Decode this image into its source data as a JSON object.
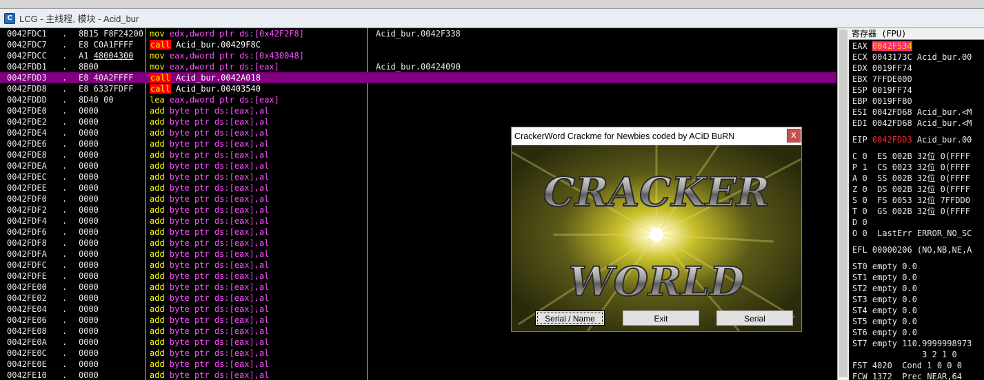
{
  "window": {
    "title": "LCG - 主线程, 模块 - Acid_bur"
  },
  "disasm": [
    {
      "addr": "0042FDC1",
      "dot": ".",
      "hex": "8B15 F8F24200",
      "ins": [
        {
          "t": "mov ",
          "c": "kw-mov"
        },
        {
          "t": "edx",
          "c": "reg"
        },
        {
          "t": ",dword ptr ds:[0x42F2F8]",
          "c": "op"
        }
      ],
      "comment": "Acid_bur.0042F338"
    },
    {
      "addr": "0042FDC7",
      "dot": ".",
      "hex": "E8 C0A1FFFF",
      "ins": [
        {
          "t": "call",
          "c": "call"
        },
        {
          "t": " Acid_bur.00429F8C",
          "c": "cname"
        }
      ],
      "comment": ""
    },
    {
      "addr": "0042FDCC",
      "dot": ".",
      "hex": "A1 48004300",
      "hexu": true,
      "ins": [
        {
          "t": "mov ",
          "c": "kw-mov"
        },
        {
          "t": "eax",
          "c": "reg"
        },
        {
          "t": ",dword ptr ds:[0x430048]",
          "c": "op"
        }
      ],
      "comment": ""
    },
    {
      "addr": "0042FDD1",
      "dot": ".",
      "hex": "8B00",
      "ins": [
        {
          "t": "mov ",
          "c": "kw-mov"
        },
        {
          "t": "eax",
          "c": "reg"
        },
        {
          "t": ",dword ptr ds:[eax]",
          "c": "op"
        }
      ],
      "comment": "Acid_bur.00424090"
    },
    {
      "addr": "0042FDD3",
      "dot": ".",
      "hex": "E8 40A2FFFF",
      "sel": true,
      "ins": [
        {
          "t": "call",
          "c": "call"
        },
        {
          "t": " Acid_bur.0042A018",
          "c": "cname"
        }
      ],
      "comment": ""
    },
    {
      "addr": "0042FDD8",
      "dot": ".",
      "hex": "E8 6337FDFF",
      "ins": [
        {
          "t": "call",
          "c": "call"
        },
        {
          "t": " Acid_bur.00403540",
          "c": "cname"
        }
      ],
      "comment": ""
    },
    {
      "addr": "0042FDDD",
      "dot": ".",
      "hex": "8D40 00",
      "ins": [
        {
          "t": "lea ",
          "c": "kw-lea"
        },
        {
          "t": "eax",
          "c": "reg"
        },
        {
          "t": ",dword ptr ds:[eax]",
          "c": "op"
        }
      ],
      "comment": ""
    },
    {
      "addr": "0042FDE0",
      "dot": ".",
      "hex": "0000",
      "add": true
    },
    {
      "addr": "0042FDE2",
      "dot": ".",
      "hex": "0000",
      "add": true
    },
    {
      "addr": "0042FDE4",
      "dot": ".",
      "hex": "0000",
      "add": true
    },
    {
      "addr": "0042FDE6",
      "dot": ".",
      "hex": "0000",
      "add": true
    },
    {
      "addr": "0042FDE8",
      "dot": ".",
      "hex": "0000",
      "add": true
    },
    {
      "addr": "0042FDEA",
      "dot": ".",
      "hex": "0000",
      "add": true
    },
    {
      "addr": "0042FDEC",
      "dot": ".",
      "hex": "0000",
      "add": true
    },
    {
      "addr": "0042FDEE",
      "dot": ".",
      "hex": "0000",
      "add": true
    },
    {
      "addr": "0042FDF0",
      "dot": ".",
      "hex": "0000",
      "add": true
    },
    {
      "addr": "0042FDF2",
      "dot": ".",
      "hex": "0000",
      "add": true
    },
    {
      "addr": "0042FDF4",
      "dot": ".",
      "hex": "0000",
      "add": true
    },
    {
      "addr": "0042FDF6",
      "dot": ".",
      "hex": "0000",
      "add": true
    },
    {
      "addr": "0042FDF8",
      "dot": ".",
      "hex": "0000",
      "add": true
    },
    {
      "addr": "0042FDFA",
      "dot": ".",
      "hex": "0000",
      "add": true
    },
    {
      "addr": "0042FDFC",
      "dot": ".",
      "hex": "0000",
      "add": true
    },
    {
      "addr": "0042FDFE",
      "dot": ".",
      "hex": "0000",
      "add": true
    },
    {
      "addr": "0042FE00",
      "dot": ".",
      "hex": "0000",
      "add": true
    },
    {
      "addr": "0042FE02",
      "dot": ".",
      "hex": "0000",
      "add": true
    },
    {
      "addr": "0042FE04",
      "dot": ".",
      "hex": "0000",
      "add": true
    },
    {
      "addr": "0042FE06",
      "dot": ".",
      "hex": "0000",
      "add": true
    },
    {
      "addr": "0042FE08",
      "dot": ".",
      "hex": "0000",
      "add": true
    },
    {
      "addr": "0042FE0A",
      "dot": ".",
      "hex": "0000",
      "add": true
    },
    {
      "addr": "0042FE0C",
      "dot": ".",
      "hex": "0000",
      "add": true
    },
    {
      "addr": "0042FE0E",
      "dot": ".",
      "hex": "0000",
      "add": true
    },
    {
      "addr": "0042FE10",
      "dot": ".",
      "hex": "0000",
      "add": true
    }
  ],
  "add_instr": {
    "kw": "add ",
    "rest": "byte ptr ds:[eax],al"
  },
  "registers": {
    "header": "寄存器 (FPU)",
    "lines": [
      {
        "parts": [
          {
            "t": "EAX "
          },
          {
            "t": "0042F534",
            "c": "hl"
          }
        ]
      },
      {
        "parts": [
          {
            "t": "ECX 0043173C Acid_bur.00"
          }
        ]
      },
      {
        "parts": [
          {
            "t": "EDX 0019FF74"
          }
        ]
      },
      {
        "parts": [
          {
            "t": "EBX 7FFDE000"
          }
        ]
      },
      {
        "parts": [
          {
            "t": "ESP 0019FF74"
          }
        ]
      },
      {
        "parts": [
          {
            "t": "EBP 0019FF80"
          }
        ]
      },
      {
        "parts": [
          {
            "t": "ESI 0042FD68 Acid_bur.<M"
          }
        ]
      },
      {
        "parts": [
          {
            "t": "EDI 0042FD68 Acid_bur.<M"
          }
        ]
      },
      {
        "gap": true
      },
      {
        "parts": [
          {
            "t": "EIP "
          },
          {
            "t": "0042FDD3",
            "c": "red"
          },
          {
            "t": " Acid_bur.00"
          }
        ]
      },
      {
        "gap": true
      },
      {
        "parts": [
          {
            "t": "C 0  ES 002B 32位 0(FFFF"
          }
        ]
      },
      {
        "parts": [
          {
            "t": "P 1  CS 0023 32位 0(FFFF"
          }
        ]
      },
      {
        "parts": [
          {
            "t": "A 0  SS 002B 32位 0(FFFF"
          }
        ]
      },
      {
        "parts": [
          {
            "t": "Z 0  DS 002B 32位 0(FFFF"
          }
        ]
      },
      {
        "parts": [
          {
            "t": "S 0  FS 0053 32位 7FFDD0"
          }
        ]
      },
      {
        "parts": [
          {
            "t": "T 0  GS 002B 32位 0(FFFF"
          }
        ]
      },
      {
        "parts": [
          {
            "t": "D 0"
          }
        ]
      },
      {
        "parts": [
          {
            "t": "O 0  LastErr ERROR_NO_SC"
          }
        ]
      },
      {
        "gap": true
      },
      {
        "parts": [
          {
            "t": "EFL 00000206 (NO,NB,NE,A"
          }
        ]
      },
      {
        "gap": true
      },
      {
        "parts": [
          {
            "t": "ST0 empty 0.0"
          }
        ]
      },
      {
        "parts": [
          {
            "t": "ST1 empty 0.0"
          }
        ]
      },
      {
        "parts": [
          {
            "t": "ST2 empty 0.0"
          }
        ]
      },
      {
        "parts": [
          {
            "t": "ST3 empty 0.0"
          }
        ]
      },
      {
        "parts": [
          {
            "t": "ST4 empty 0.0"
          }
        ]
      },
      {
        "parts": [
          {
            "t": "ST5 empty 0.0"
          }
        ]
      },
      {
        "parts": [
          {
            "t": "ST6 empty 0.0"
          }
        ]
      },
      {
        "parts": [
          {
            "t": "ST7 empty 110.9999998973"
          }
        ]
      },
      {
        "parts": [
          {
            "t": "              3 2 1 0"
          }
        ]
      },
      {
        "parts": [
          {
            "t": "FST 4020  Cond 1 0 0 0"
          }
        ]
      },
      {
        "parts": [
          {
            "t": "FCW 1372  Prec NEAR,64"
          }
        ]
      }
    ]
  },
  "dialog": {
    "title": "CrackerWord Crackme for Newbies coded by ACiD BuRN",
    "close": "x",
    "logo_word1": "CRACKER",
    "logo_word2": "WORLD",
    "buttons": [
      "Serial / Name",
      "Exit",
      "Serial"
    ]
  },
  "colors": {
    "selection": "#800080",
    "call_bg": "#ff0000",
    "keyword": "#ffff00",
    "operand": "#ff4dff"
  }
}
